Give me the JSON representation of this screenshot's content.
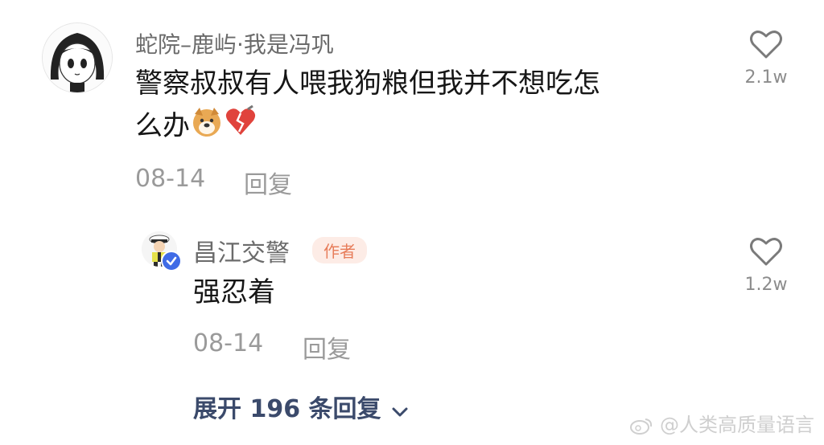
{
  "comment": {
    "username": "蛇院–鹿屿·我是冯巩",
    "text_line1": "警察叔叔有人喂我狗粮但我并不想吃怎",
    "text_line2": "么办",
    "emojis": [
      "doge-emoji",
      "broken-heart-emoji"
    ],
    "date": "08-14",
    "reply_label": "回复",
    "likes": "2.1w"
  },
  "reply": {
    "username": "昌江交警",
    "badge": "作者",
    "text": "强忍着",
    "date": "08-14",
    "reply_label": "回复",
    "likes": "1.2w",
    "verified": true
  },
  "expand_label": "展开 196 条回复",
  "watermark": "@人类高质量语言",
  "colors": {
    "accent": "#3b4a6b",
    "badge_bg": "#fdece6",
    "badge_text": "#e77d5a",
    "verified": "#3f6be6"
  }
}
